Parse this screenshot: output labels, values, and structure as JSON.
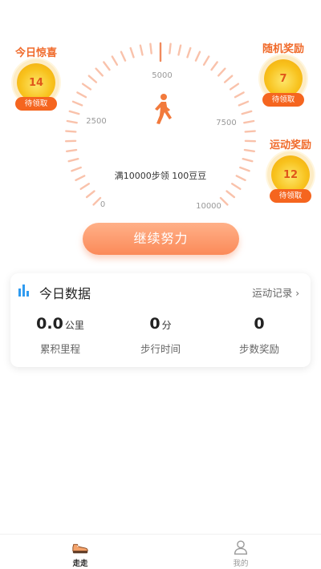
{
  "gauge": {
    "tick_labels": [
      "0",
      "2500",
      "5000",
      "7500",
      "10000"
    ],
    "goal_text": "满10000步领 100豆豆",
    "walker_icon": "walking-person-icon"
  },
  "rewards": [
    {
      "title": "今日惊喜",
      "value": "14",
      "status": "待领取"
    },
    {
      "title": "随机奖励",
      "value": "7",
      "status": "待领取"
    },
    {
      "title": "运动奖励",
      "value": "12",
      "status": "待领取"
    }
  ],
  "main_button": "继续努力",
  "today": {
    "title": "今日数据",
    "link": "运动记录",
    "stats": [
      {
        "value": "0.0",
        "unit": "公里",
        "label": "累积里程"
      },
      {
        "value": "0",
        "unit": "分",
        "label": "步行时间"
      },
      {
        "value": "0",
        "unit": "",
        "label": "步数奖励"
      }
    ]
  },
  "tabs": [
    {
      "label": "走走",
      "icon": "sneaker-icon",
      "active": true
    },
    {
      "label": "我的",
      "icon": "person-icon",
      "active": false
    }
  ],
  "colors": {
    "accent": "#f06a2a",
    "tick": "#f9c2ab",
    "button": "#fb8a59",
    "coin": "#f8c21d"
  }
}
